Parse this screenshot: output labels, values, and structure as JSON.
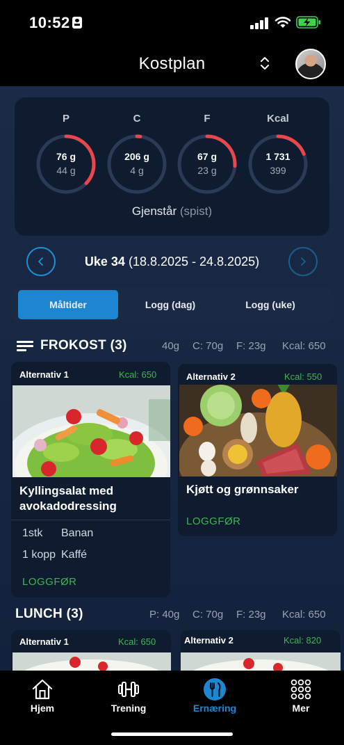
{
  "status_bar": {
    "time": "10:52"
  },
  "header": {
    "title": "Kostplan"
  },
  "macros": [
    {
      "label": "P",
      "remaining": "76 g",
      "eaten": "44 g",
      "progress": 0.37
    },
    {
      "label": "C",
      "remaining": "206 g",
      "eaten": "4 g",
      "progress": 0.02
    },
    {
      "label": "F",
      "remaining": "67 g",
      "eaten": "23 g",
      "progress": 0.26
    },
    {
      "label": "Kcal",
      "remaining": "1 731",
      "eaten": "399",
      "progress": 0.19
    }
  ],
  "macro_footer": {
    "main": "Gjenstår",
    "muted": "(spist)"
  },
  "week": {
    "label": "Uke 34",
    "range": "(18.8.2025 - 24.8.2025)"
  },
  "tabs": [
    {
      "label": "Måltider",
      "active": true
    },
    {
      "label": "Logg (dag)",
      "active": false
    },
    {
      "label": "Logg (uke)",
      "active": false
    }
  ],
  "frokost": {
    "title": "FROKOST (3)",
    "macros": [
      "40g",
      "C: 70g",
      "F: 23g",
      "Kcal: 650"
    ],
    "alternatives": [
      {
        "label": "Alternativ 1",
        "kcal": "Kcal: 650",
        "name_line1": "Kyllingsalat med",
        "name_line2": "avokadodressing",
        "ingredients": [
          {
            "qty": "1stk",
            "name": "Banan"
          },
          {
            "qty": "1 kopp",
            "name": "Kaffé"
          }
        ],
        "log_label": "LOGGFØR"
      },
      {
        "label": "Alternativ 2",
        "kcal": "Kcal: 550",
        "name_line1": "Kjøtt og grønnsaker",
        "log_label": "LOGGFØR"
      }
    ]
  },
  "lunch": {
    "title": "LUNCH (3)",
    "macros": [
      "P: 40g",
      "C: 70g",
      "F: 23g",
      "Kcal: 650"
    ],
    "alternatives": [
      {
        "label": "Alternativ 1",
        "kcal": "Kcal: 650"
      },
      {
        "label": "Alternativ 2",
        "kcal": "Kcal: 820"
      }
    ]
  },
  "nav": [
    {
      "label": "Hjem",
      "icon": "home-icon",
      "active": false
    },
    {
      "label": "Trening",
      "icon": "dumbbell-icon",
      "active": false
    },
    {
      "label": "Ernæring",
      "icon": "fork-knife-icon",
      "active": true
    },
    {
      "label": "Mer",
      "icon": "grid-icon",
      "active": false
    }
  ],
  "colors": {
    "accent": "#1d86d0",
    "ring_progress": "#e8484d",
    "ring_track": "#2b3a57",
    "success": "#3fb653",
    "card": "#0f1b2e"
  }
}
